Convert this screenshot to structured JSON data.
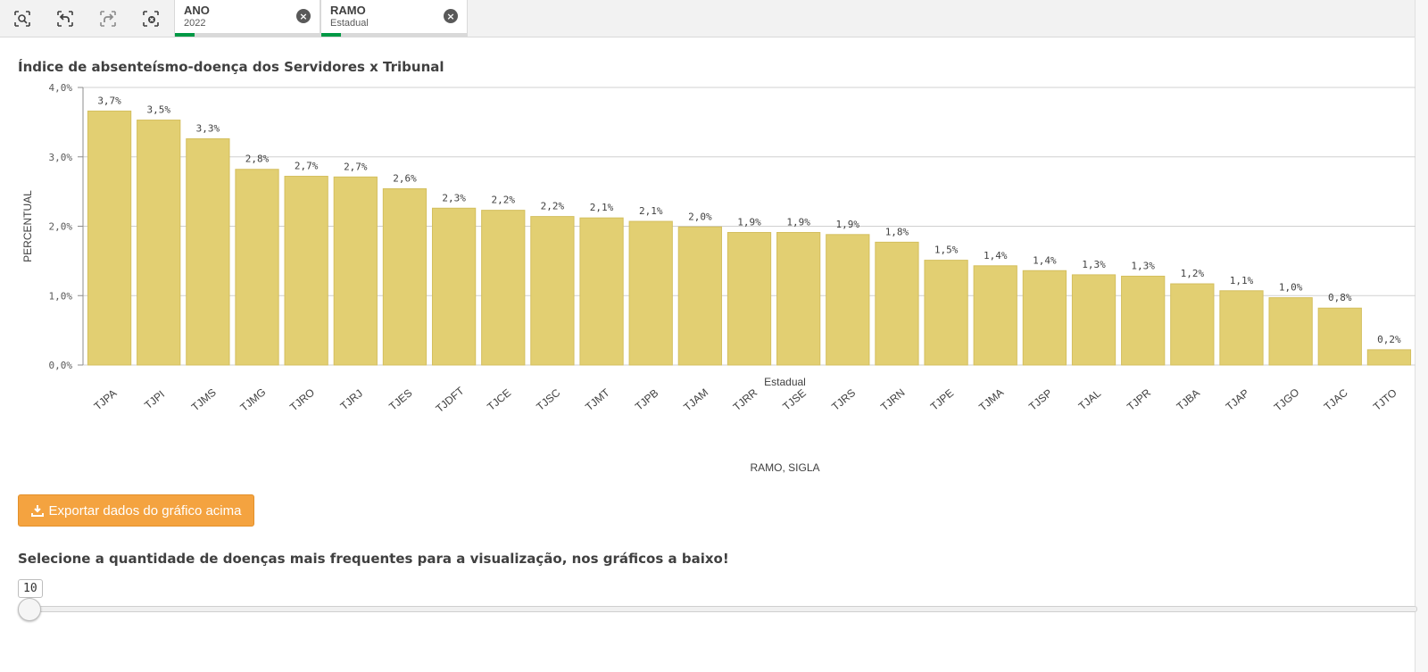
{
  "toolbar": {
    "tools": [
      {
        "name": "smart-search-icon"
      },
      {
        "name": "step-back-icon"
      },
      {
        "name": "step-forward-icon"
      },
      {
        "name": "clear-selections-icon"
      }
    ],
    "chips": [
      {
        "title": "ANO",
        "value": "2022"
      },
      {
        "title": "RAMO",
        "value": "Estadual"
      }
    ],
    "clear_icon": "×"
  },
  "chart": {
    "title": "Índice de absenteísmo-doença dos Servidores x Tribunal"
  },
  "chart_data": {
    "type": "bar",
    "title": "Índice de absenteísmo-doença dos Servidores x Tribunal",
    "ylabel": "PERCENTUAL",
    "xlabel": "RAMO, SIGLA",
    "group_label": "Estadual",
    "yticks": [
      "0,0%",
      "1,0%",
      "2,0%",
      "3,0%",
      "4,0%"
    ],
    "ylim": [
      0,
      4.0
    ],
    "grid": true,
    "bar_color": "#e2cf72",
    "categories": [
      "TJPA",
      "TJPI",
      "TJMS",
      "TJMG",
      "TJRO",
      "TJRJ",
      "TJES",
      "TJDFT",
      "TJCE",
      "TJSC",
      "TJMT",
      "TJPB",
      "TJAM",
      "TJRR",
      "TJSE",
      "TJRS",
      "TJRN",
      "TJPE",
      "TJMA",
      "TJSP",
      "TJAL",
      "TJPR",
      "TJBA",
      "TJAP",
      "TJGO",
      "TJAC",
      "TJTO"
    ],
    "values": [
      3.66,
      3.53,
      3.26,
      2.82,
      2.72,
      2.71,
      2.54,
      2.26,
      2.23,
      2.14,
      2.12,
      2.07,
      1.99,
      1.91,
      1.91,
      1.88,
      1.77,
      1.51,
      1.43,
      1.36,
      1.3,
      1.28,
      1.17,
      1.07,
      0.97,
      0.82,
      0.22
    ],
    "labels": [
      "3,7%",
      "3,5%",
      "3,3%",
      "2,8%",
      "2,7%",
      "2,7%",
      "2,6%",
      "2,3%",
      "2,2%",
      "2,2%",
      "2,1%",
      "2,1%",
      "2,0%",
      "1,9%",
      "1,9%",
      "1,9%",
      "1,8%",
      "1,5%",
      "1,4%",
      "1,4%",
      "1,3%",
      "1,3%",
      "1,2%",
      "1,1%",
      "1,0%",
      "0,8%",
      "0,2%"
    ]
  },
  "export_button": {
    "label": "Exportar dados do gráfico acima",
    "icon": "download-icon",
    "color": "#f4a340"
  },
  "disease_selector": {
    "title": "Selecione a quantidade de doenças mais frequentes para a visualização, nos gráficos a baixo!",
    "value": "10"
  }
}
